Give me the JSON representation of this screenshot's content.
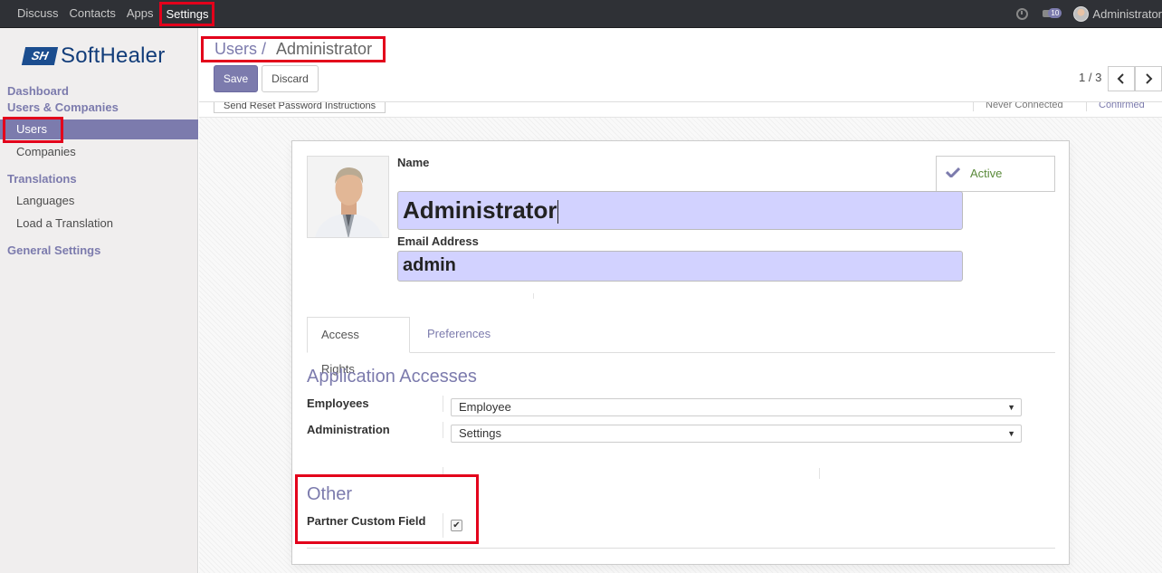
{
  "topbar": {
    "menu": [
      "Discuss",
      "Contacts",
      "Apps",
      "Settings"
    ],
    "active_menu": "Settings",
    "chat_count": "10",
    "username": "Administrator"
  },
  "sidebar": {
    "logo_mark": "SH",
    "logo_text": "SoftHealer",
    "sections": {
      "dashboard": "Dashboard",
      "users_companies": "Users & Companies",
      "translations": "Translations",
      "general_settings": "General Settings"
    },
    "items": {
      "users": "Users",
      "companies": "Companies",
      "languages": "Languages",
      "load_translation": "Load a Translation"
    }
  },
  "control_panel": {
    "breadcrumb_parent": "Users /",
    "breadcrumb_current": "Administrator",
    "save_label": "Save",
    "discard_label": "Discard",
    "pager": "1 / 3",
    "prev_icon": "chevron-left-icon",
    "next_icon": "chevron-right-icon"
  },
  "statusbar": {
    "reset_button": "Send Reset Password Instructions",
    "states": [
      "Never Connected",
      "Confirmed"
    ]
  },
  "form": {
    "active_label": "Active",
    "name_label": "Name",
    "name_value": "Administrator",
    "email_label": "Email Address",
    "email_value": "admin",
    "tabs": [
      "Access Rights",
      "Preferences"
    ],
    "app_access_title": "Application Accesses",
    "employees_label": "Employees",
    "employees_value": "Employee",
    "administration_label": "Administration",
    "administration_value": "Settings",
    "other_title": "Other",
    "partner_custom_field_label": "Partner Custom Field",
    "partner_custom_field_checked": true
  },
  "colors": {
    "accent": "#7c7bad",
    "topbar": "#2f3136",
    "highlight_red": "#e3001b",
    "input_bg": "#d2d2ff"
  }
}
